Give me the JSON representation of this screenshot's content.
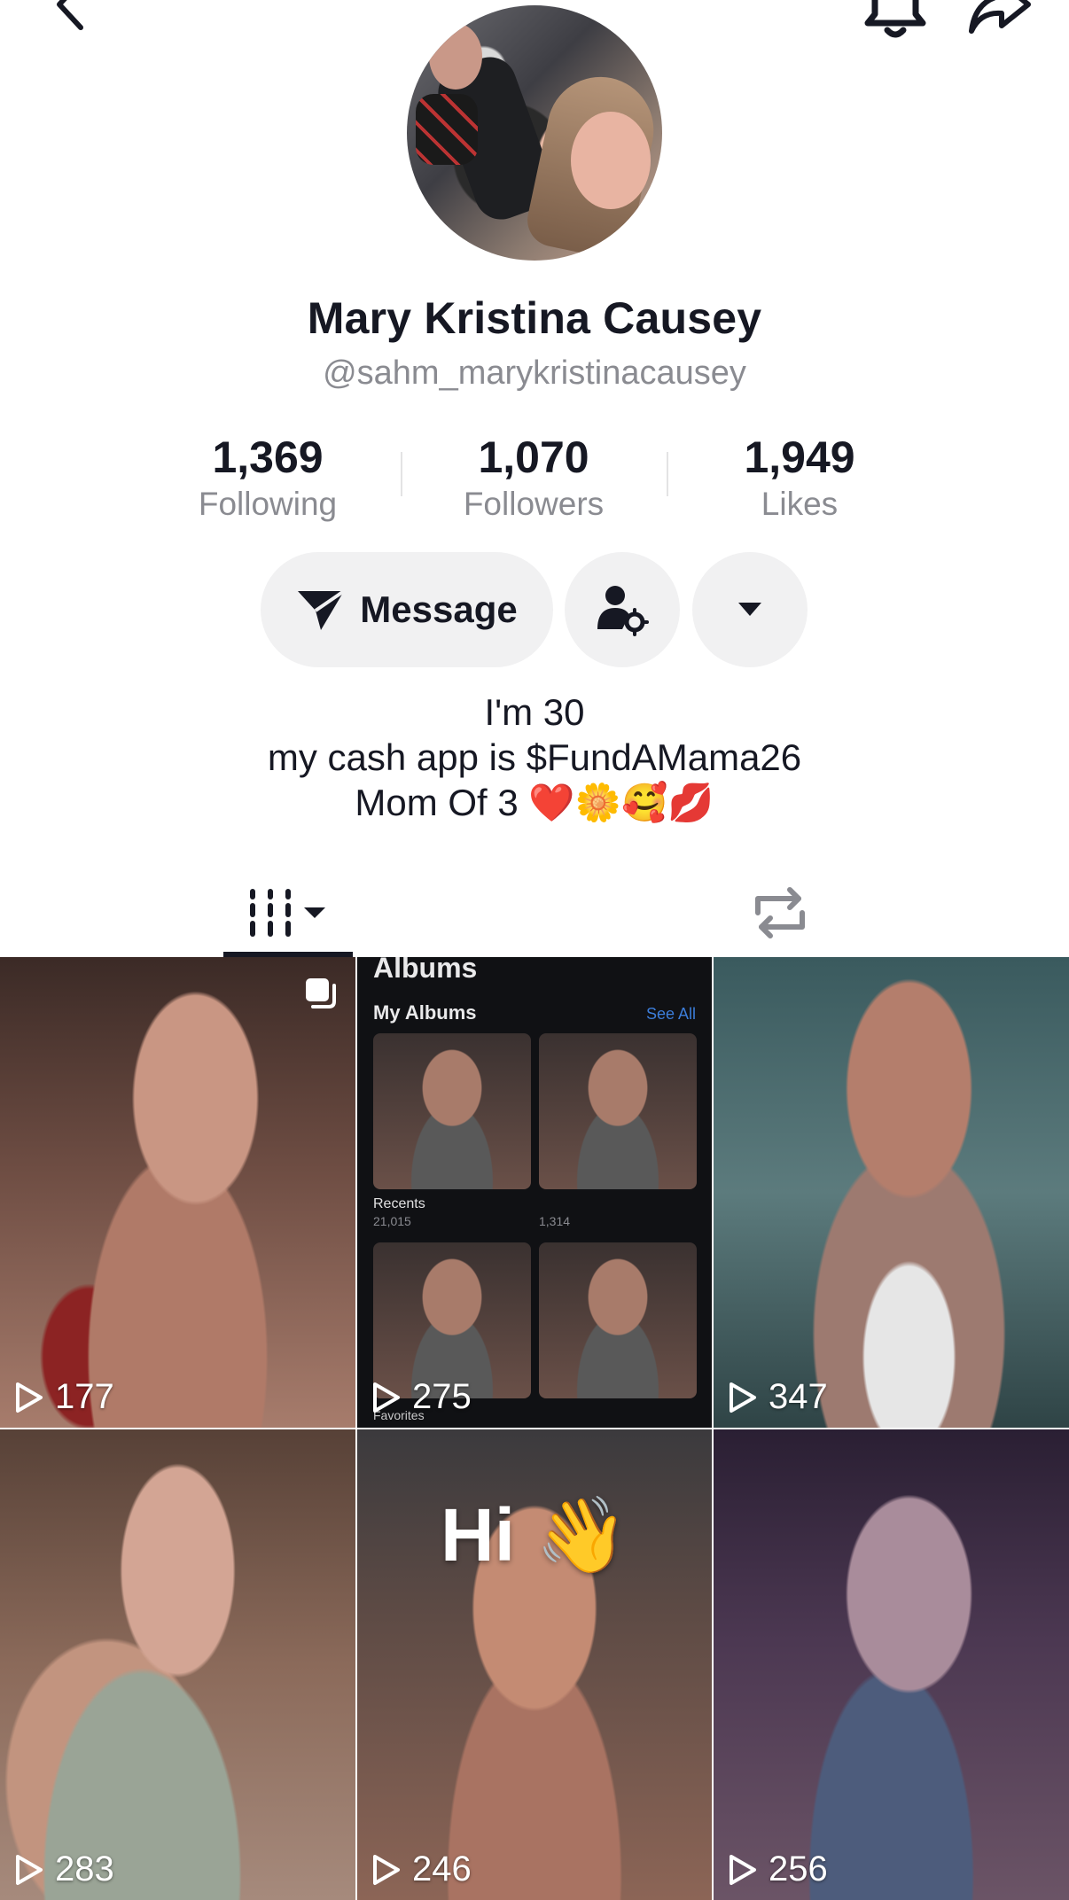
{
  "profile": {
    "name": "Mary Kristina Causey",
    "handle": "@sahm_marykristinacausey"
  },
  "stats": [
    {
      "value": "1,369",
      "label": "Following"
    },
    {
      "value": "1,070",
      "label": "Followers"
    },
    {
      "value": "1,949",
      "label": "Likes"
    }
  ],
  "actions": {
    "message_label": "Message"
  },
  "bio": {
    "line1": "I'm 30",
    "line2": "my cash app is $FundAMama26",
    "line3": "Mom Of 3 ❤️🌼🥰💋"
  },
  "albums_tile": {
    "title": "Albums",
    "my_albums": "My Albums",
    "see_all": "See All",
    "recents": "Recents",
    "recents_count": "21,015",
    "favorites_count": "1,314",
    "favorites": "Favorites"
  },
  "videos": [
    {
      "views": "177",
      "pinned": true
    },
    {
      "views": "275"
    },
    {
      "views": "347"
    },
    {
      "views": "283"
    },
    {
      "views": "246",
      "overlay_text": "Hi 👋"
    },
    {
      "views": "256"
    }
  ],
  "icons": {
    "back": "chevron-left-icon",
    "notifications": "bell-icon",
    "share": "share-arrow-icon",
    "message": "send-icon",
    "friends": "person-settings-icon",
    "more": "caret-down-icon",
    "videos_tab": "grid-columns-icon",
    "repost_tab": "repost-icon",
    "play": "play-icon",
    "pinned": "pinned-icon"
  }
}
